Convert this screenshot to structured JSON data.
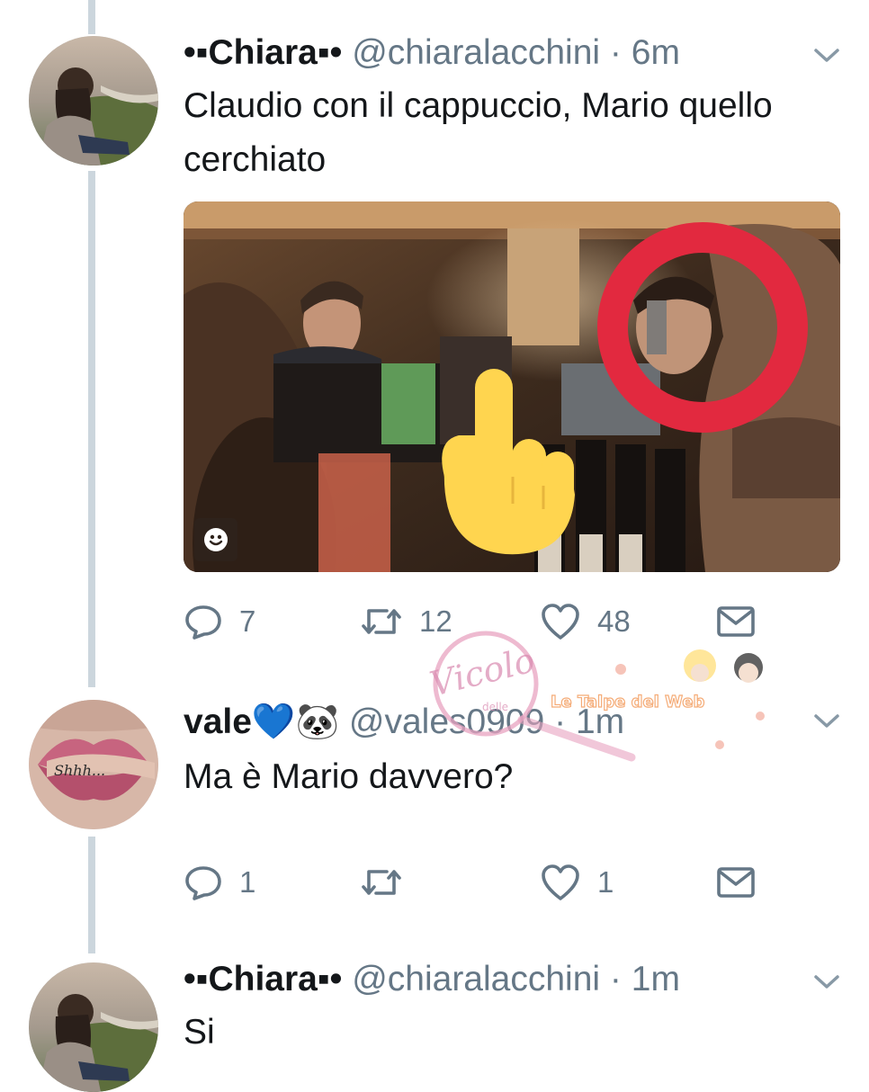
{
  "tweets": [
    {
      "display_name": "•▪Chiara▪•",
      "handle": "@chiaralacchini",
      "separator": "·",
      "time": "6m",
      "text": "Claudio con il cappuccio, Mario quello cerchiato",
      "has_media": true,
      "media": {
        "badge_icon": "smiley-icon"
      },
      "actions": {
        "replies": "7",
        "retweets": "12",
        "likes": "48"
      }
    },
    {
      "display_name": "vale💙🐼",
      "handle": "@vales0909",
      "separator": "·",
      "time": "1m",
      "text": "Ma è Mario davvero?",
      "avatar_text": "Shhh...",
      "has_media": false,
      "actions": {
        "replies": "1",
        "retweets": "",
        "likes": "1"
      }
    },
    {
      "display_name": "•▪Chiara▪•",
      "handle": "@chiaralacchini",
      "separator": "·",
      "time": "1m",
      "text": "Si",
      "has_media": false
    }
  ],
  "watermark": {
    "line1": "Vicolo",
    "line2": "delle",
    "line3": "Le Talpe del Web"
  },
  "colors": {
    "text": "#14171a",
    "secondary": "#657786",
    "thread_line": "#ccd6dd",
    "circle_annotation": "#e2293f",
    "pointer_emoji": "#ffd54f"
  },
  "icons": [
    "reply-icon",
    "retweet-icon",
    "like-icon",
    "message-icon",
    "chevron-down-icon"
  ]
}
